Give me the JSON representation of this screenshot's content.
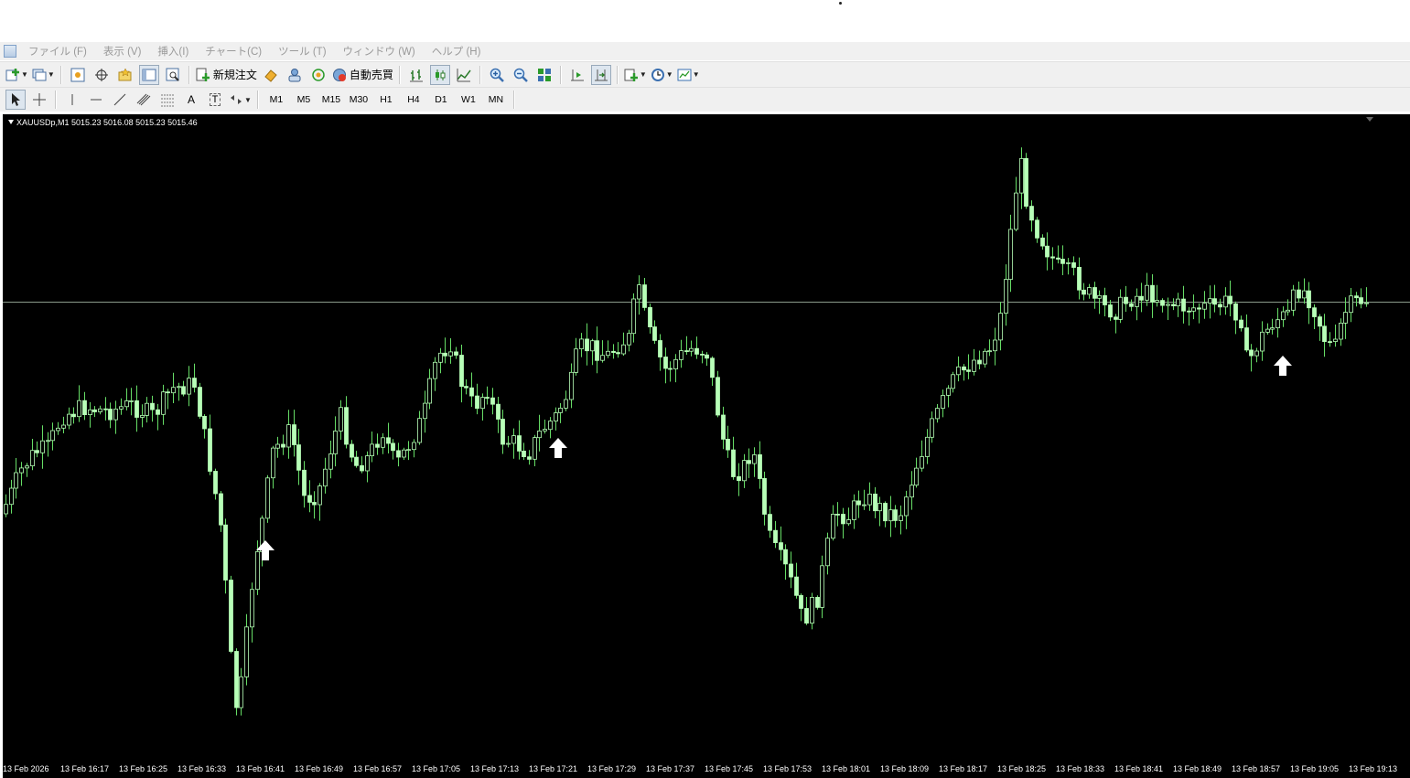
{
  "menu": {
    "items": [
      "ファイル (F)",
      "表示 (V)",
      "挿入(I)",
      "チャート(C)",
      "ツール (T)",
      "ウィンドウ (W)",
      "ヘルプ (H)"
    ]
  },
  "toolbar": {
    "new_order_label": "新規注文",
    "auto_trading_label": "自動売買",
    "timeframes": [
      "M1",
      "M5",
      "M15",
      "M30",
      "H1",
      "H4",
      "D1",
      "W1",
      "MN"
    ],
    "text_tool_label": "A",
    "text_label_tool_label": "T"
  },
  "chart": {
    "header": "XAUUSDp,M1  5015.23 5016.08 5015.23 5015.46",
    "time_labels": [
      "13 Feb 2026",
      "13 Feb 16:17",
      "13 Feb 16:25",
      "13 Feb 16:33",
      "13 Feb 16:41",
      "13 Feb 16:49",
      "13 Feb 16:57",
      "13 Feb 17:05",
      "13 Feb 17:13",
      "13 Feb 17:21",
      "13 Feb 17:29",
      "13 Feb 17:37",
      "13 Feb 17:45",
      "13 Feb 17:53",
      "13 Feb 18:01",
      "13 Feb 18:09",
      "13 Feb 18:17",
      "13 Feb 18:25",
      "13 Feb 18:33",
      "13 Feb 18:41",
      "13 Feb 18:49",
      "13 Feb 18:57",
      "13 Feb 19:05",
      "13 Feb 19:13"
    ],
    "colors": {
      "background": "#000000",
      "candle": "#b8ffb8",
      "wick": "#66dd66",
      "bid_line": "#8a9a8a",
      "arrow": "#ffffff"
    },
    "icons": [
      "up-arrow-icon",
      "up-arrow-icon",
      "up-arrow-icon"
    ]
  }
}
